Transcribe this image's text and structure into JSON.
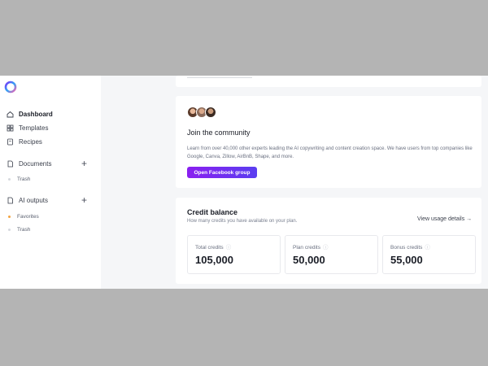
{
  "sidebar": {
    "logo_icon": "brand-logo",
    "nav": [
      {
        "label": "Dashboard",
        "icon": "home-icon",
        "active": true
      },
      {
        "label": "Templates",
        "icon": "grid-icon"
      },
      {
        "label": "Recipes",
        "icon": "book-icon"
      }
    ],
    "documents": {
      "label": "Documents",
      "items": [
        {
          "label": "Trash"
        }
      ]
    },
    "ai_outputs": {
      "label": "AI outputs",
      "items": [
        {
          "label": "Favorites",
          "dot_color": "#f4a340"
        },
        {
          "label": "Trash",
          "dot_color": "#d6d8de"
        }
      ]
    }
  },
  "community": {
    "title": "Join the community",
    "text": "Learn from over 40,000 other experts leading the AI copywriting and content creation space. We have users from top companies like Google, Canva, Zillow, AirBnB, Shape, and more.",
    "button_label": "Open Facebook group"
  },
  "credits": {
    "title": "Credit balance",
    "subtitle": "How many credits you have available on your plan.",
    "link_label": "View usage details →",
    "stats": [
      {
        "label": "Total credits",
        "value": "105,000"
      },
      {
        "label": "Plan credits",
        "value": "50,000"
      },
      {
        "label": "Bonus credits",
        "value": "55,000"
      }
    ]
  },
  "colors": {
    "accent_gradient_start": "#8a1ff0",
    "accent_gradient_end": "#5a3ef0"
  }
}
